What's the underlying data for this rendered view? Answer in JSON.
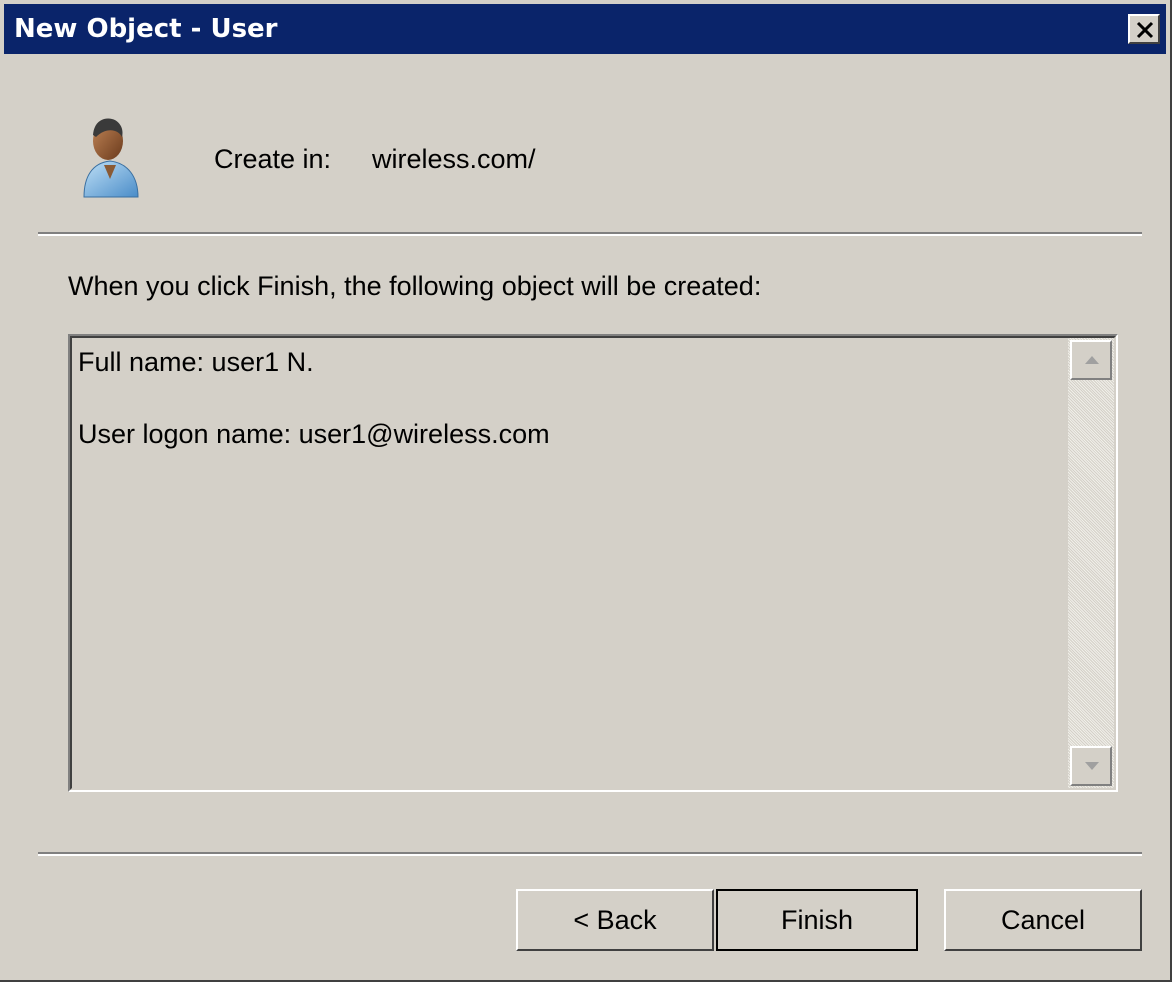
{
  "window": {
    "title": "New Object - User",
    "close_icon": "close-icon"
  },
  "header": {
    "icon": "user-icon",
    "create_in_label": "Create in:",
    "create_in_value": "wireless.com/"
  },
  "main": {
    "instruction": "When you click Finish, the following object will be created:",
    "summary_lines": [
      "Full name: user1 N.",
      "User logon name: user1@wireless.com"
    ]
  },
  "buttons": {
    "back_label": "< Back",
    "finish_label": "Finish",
    "cancel_label": "Cancel"
  },
  "colors": {
    "titlebar": "#0a246a",
    "dialog_background": "#d4d0c8"
  }
}
